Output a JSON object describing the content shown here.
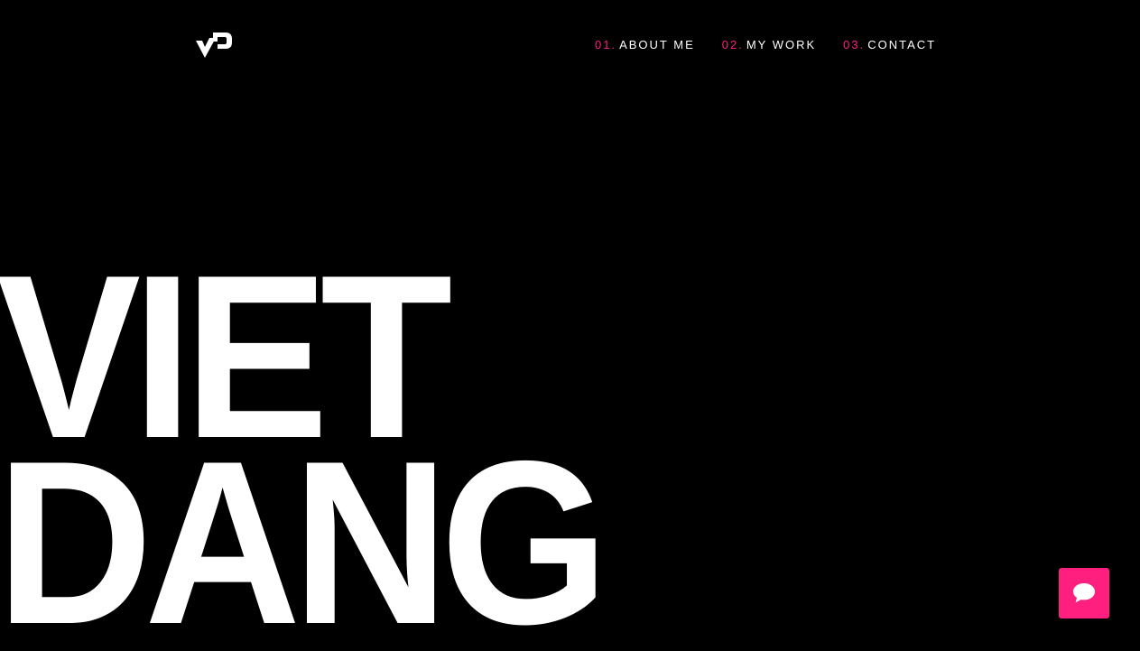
{
  "brand": {
    "logo_icon": "vd-monogram-logo"
  },
  "nav": {
    "items": [
      {
        "num": "01.",
        "label": "ABOUT ME"
      },
      {
        "num": "02.",
        "label": "MY WORK"
      },
      {
        "num": "03.",
        "label": "CONTACT"
      }
    ]
  },
  "hero": {
    "line1": "VIET",
    "line2": "DANG"
  },
  "chat": {
    "icon": "chat-bubble-icon"
  },
  "colors": {
    "background": "#000000",
    "accent": "#ff1f7f",
    "text": "#ffffff"
  }
}
